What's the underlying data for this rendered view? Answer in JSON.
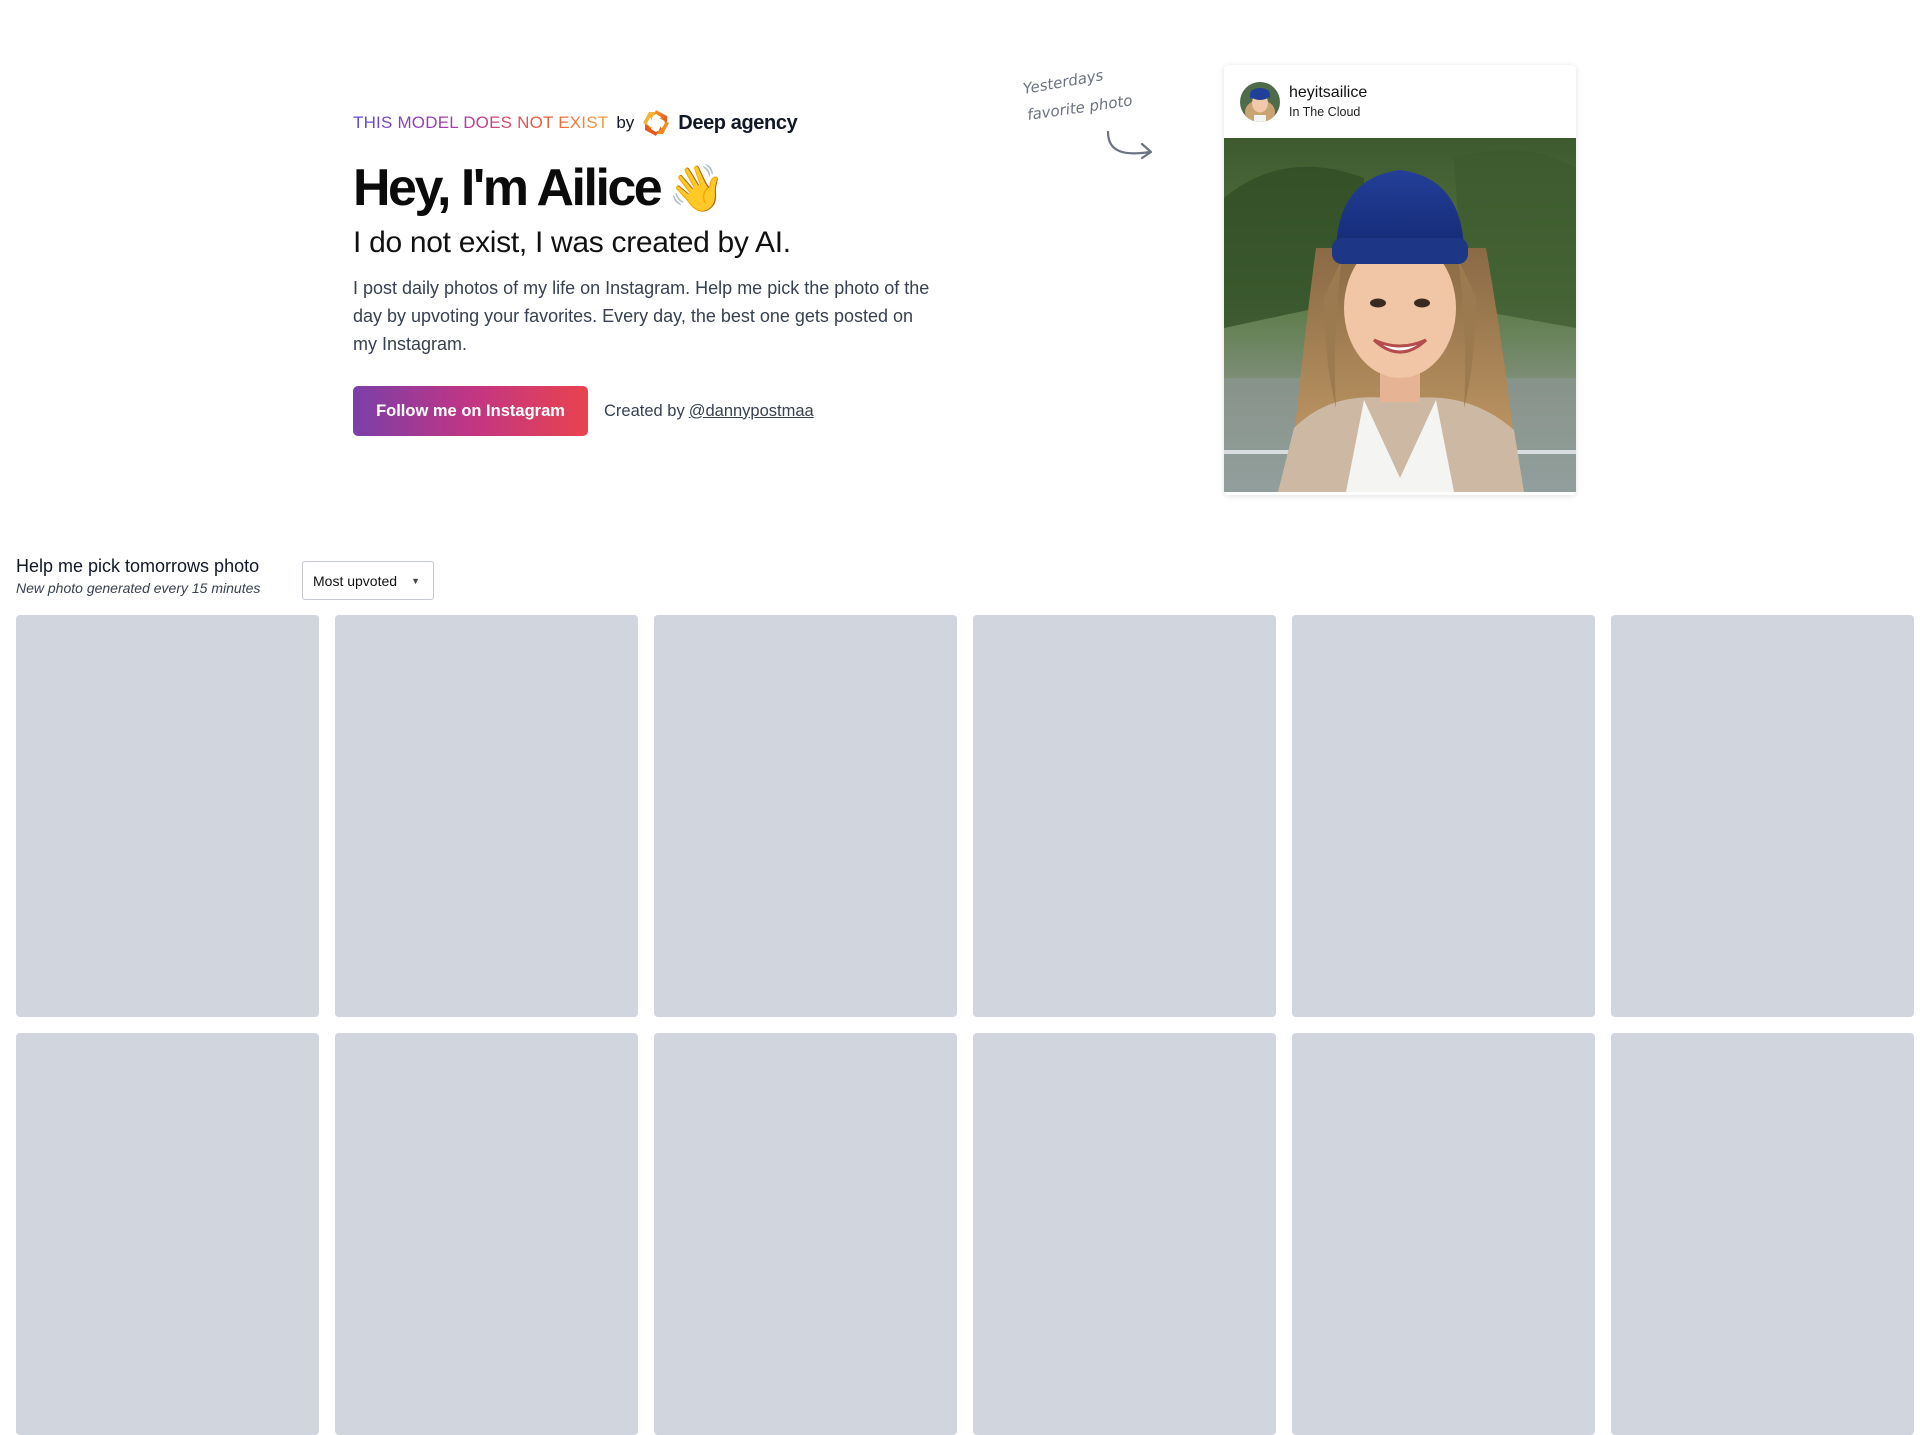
{
  "hero": {
    "tagline": "THIS MODEL DOES NOT EXIST",
    "by": "by",
    "brand_name": "Deep agency",
    "brand_icon": "deep-agency-logo-icon",
    "headline": "Hey, I'm Ailice",
    "wave_emoji": "👋",
    "subhead": "I do not exist, I was created by AI.",
    "intro": "I post daily photos of my life on Instagram. Help me pick the photo of the day by upvoting your favorites. Every day, the best one gets posted on my Instagram.",
    "cta_label": "Follow me on Instagram",
    "credit_prefix": "Created by",
    "credit_handle": "@dannypostmaa"
  },
  "annotation": {
    "line1": "Yesterdays",
    "line2": "favorite photo",
    "arrow_icon": "curved-arrow-icon"
  },
  "instagram_card": {
    "username": "heyitsailice",
    "location": "In The Cloud"
  },
  "gallery": {
    "title": "Help me pick tomorrows photo",
    "subtitle": "New photo generated every 15 minutes",
    "sort_selected": "Most upvoted",
    "caret_icon": "caret-down-icon",
    "tile_count": 12
  },
  "colors": {
    "tile_placeholder": "#d1d5de",
    "cta_gradient_start": "#7b3fa8",
    "cta_gradient_end": "#e8434f"
  }
}
